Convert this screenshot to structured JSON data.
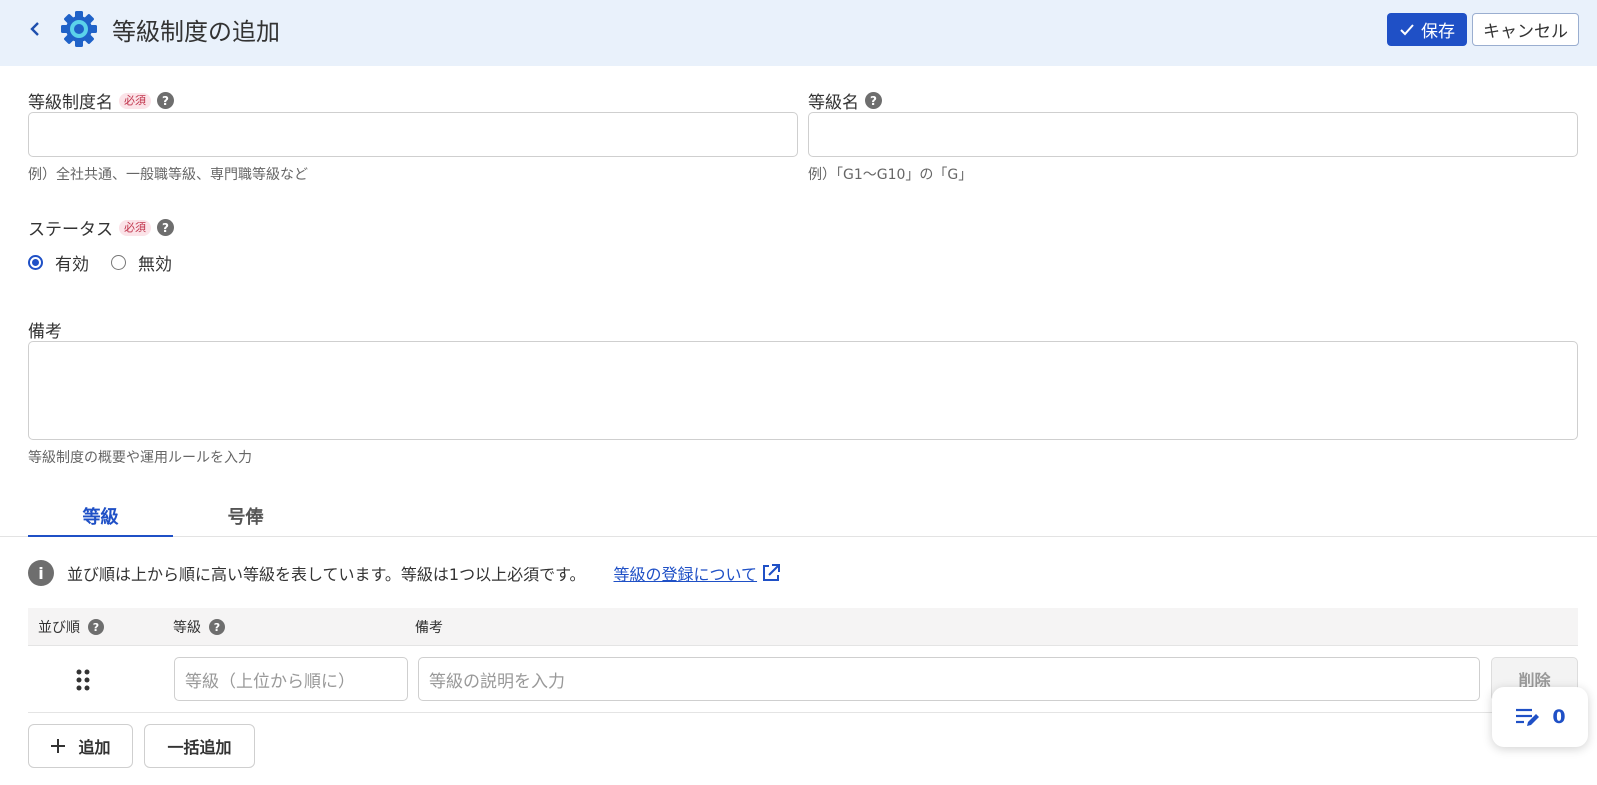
{
  "header": {
    "title": "等級制度の追加",
    "save_label": "保存",
    "cancel_label": "キャンセル"
  },
  "form": {
    "system_name": {
      "label": "等級制度名",
      "required": "必須",
      "value": "",
      "hint": "例）全社共通、一般職等級、専門職等級など"
    },
    "grade_name": {
      "label": "等級名",
      "value": "",
      "hint": "例）「G1～G10」の「G」"
    },
    "status": {
      "label": "ステータス",
      "required": "必須",
      "options": [
        "有効",
        "無効"
      ],
      "selected": "有効"
    },
    "remarks": {
      "label": "備考",
      "value": "",
      "hint": "等級制度の概要や運用ルールを入力"
    }
  },
  "tabs": [
    {
      "label": "等級",
      "active": true
    },
    {
      "label": "号俸",
      "active": false
    }
  ],
  "info": {
    "text": "並び順は上から順に高い等級を表しています。等級は1つ以上必須です。",
    "link": "等級の登録について"
  },
  "table": {
    "headers": [
      "並び順",
      "等級",
      "備考"
    ],
    "row": {
      "grade_placeholder": "等級（上位から順に）",
      "note_placeholder": "等級の説明を入力",
      "delete_label": "削除"
    }
  },
  "actions": {
    "add_label": "追加",
    "bulk_add_label": "一括追加"
  },
  "float_counter": "0",
  "colors": {
    "accent": "#1f50c6",
    "header_bg": "#e9f1fb",
    "required": "#c0334b"
  }
}
